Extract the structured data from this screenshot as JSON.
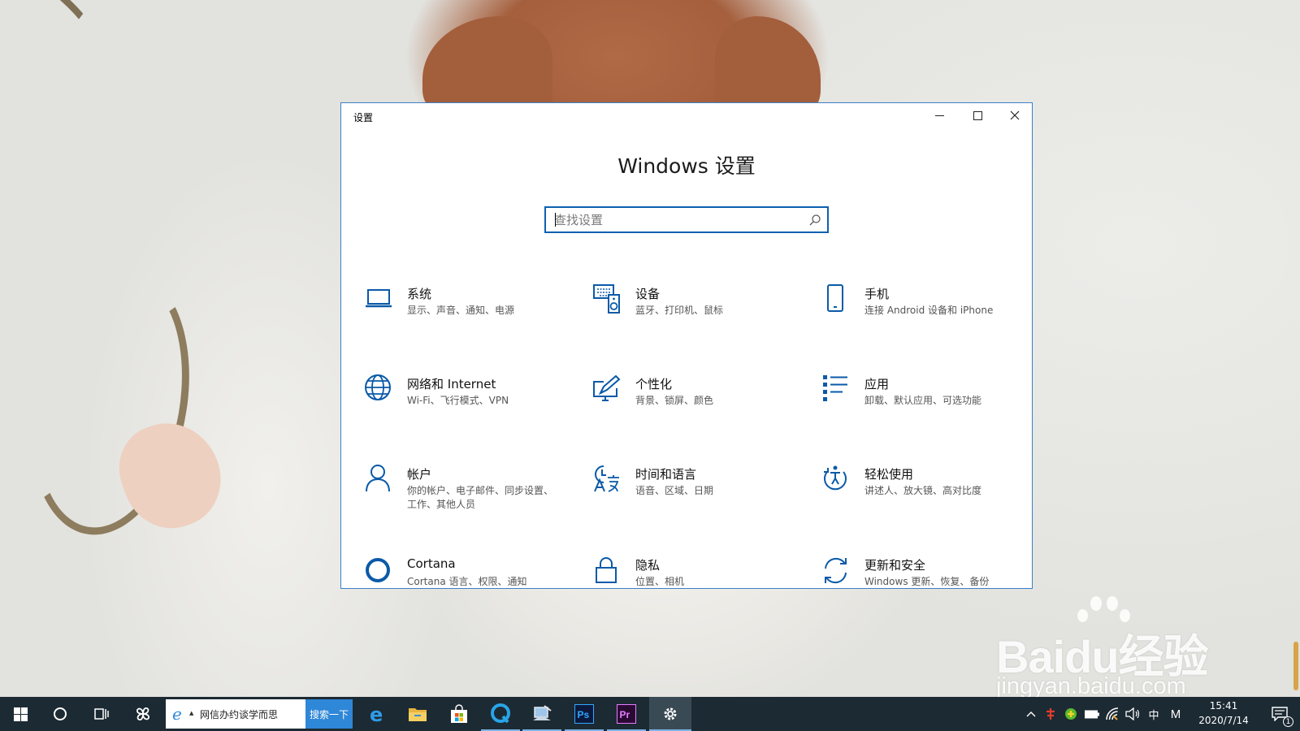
{
  "window": {
    "title": "设置",
    "heading": "Windows 设置",
    "search": {
      "placeholder": "查找设置",
      "value": ""
    },
    "tiles": [
      {
        "id": "system",
        "name": "系统",
        "desc": "显示、声音、通知、电源",
        "icon": "laptop-icon"
      },
      {
        "id": "devices",
        "name": "设备",
        "desc": "蓝牙、打印机、鼠标",
        "icon": "keyboard-speaker-icon"
      },
      {
        "id": "phone",
        "name": "手机",
        "desc": "连接 Android 设备和 iPhone",
        "icon": "phone-icon"
      },
      {
        "id": "network",
        "name": "网络和 Internet",
        "desc": "Wi-Fi、飞行模式、VPN",
        "icon": "globe-icon"
      },
      {
        "id": "personalization",
        "name": "个性化",
        "desc": "背景、锁屏、颜色",
        "icon": "paint-monitor-icon"
      },
      {
        "id": "apps",
        "name": "应用",
        "desc": "卸载、默认应用、可选功能",
        "icon": "app-list-icon"
      },
      {
        "id": "accounts",
        "name": "帐户",
        "desc": "你的帐户、电子邮件、同步设置、工作、其他人员",
        "icon": "person-icon"
      },
      {
        "id": "time-language",
        "name": "时间和语言",
        "desc": "语音、区域、日期",
        "icon": "time-language-icon"
      },
      {
        "id": "ease-of-access",
        "name": "轻松使用",
        "desc": "讲述人、放大镜、高对比度",
        "icon": "ease-of-access-icon"
      },
      {
        "id": "cortana",
        "name": "Cortana",
        "desc": "Cortana 语言、权限、通知",
        "icon": "cortana-ring-icon"
      },
      {
        "id": "privacy",
        "name": "隐私",
        "desc": "位置、相机",
        "icon": "lock-icon"
      },
      {
        "id": "update-security",
        "name": "更新和安全",
        "desc": "Windows 更新、恢复、备份",
        "icon": "refresh-icon"
      }
    ]
  },
  "taskbar": {
    "search_query": "网信办约谈学而思",
    "search_button": "搜索一下",
    "ime": "中",
    "ime_mode": "M",
    "time": "15:41",
    "date": "2020/7/14",
    "notification_count": "1"
  },
  "watermark": {
    "brand": "Baidu经验",
    "url": "jingyan.baidu.com"
  },
  "colors": {
    "accent": "#0c61b0",
    "icon": "#0a5aa8",
    "taskbar": "#1c2a33",
    "window_border": "#3c7fc6"
  }
}
